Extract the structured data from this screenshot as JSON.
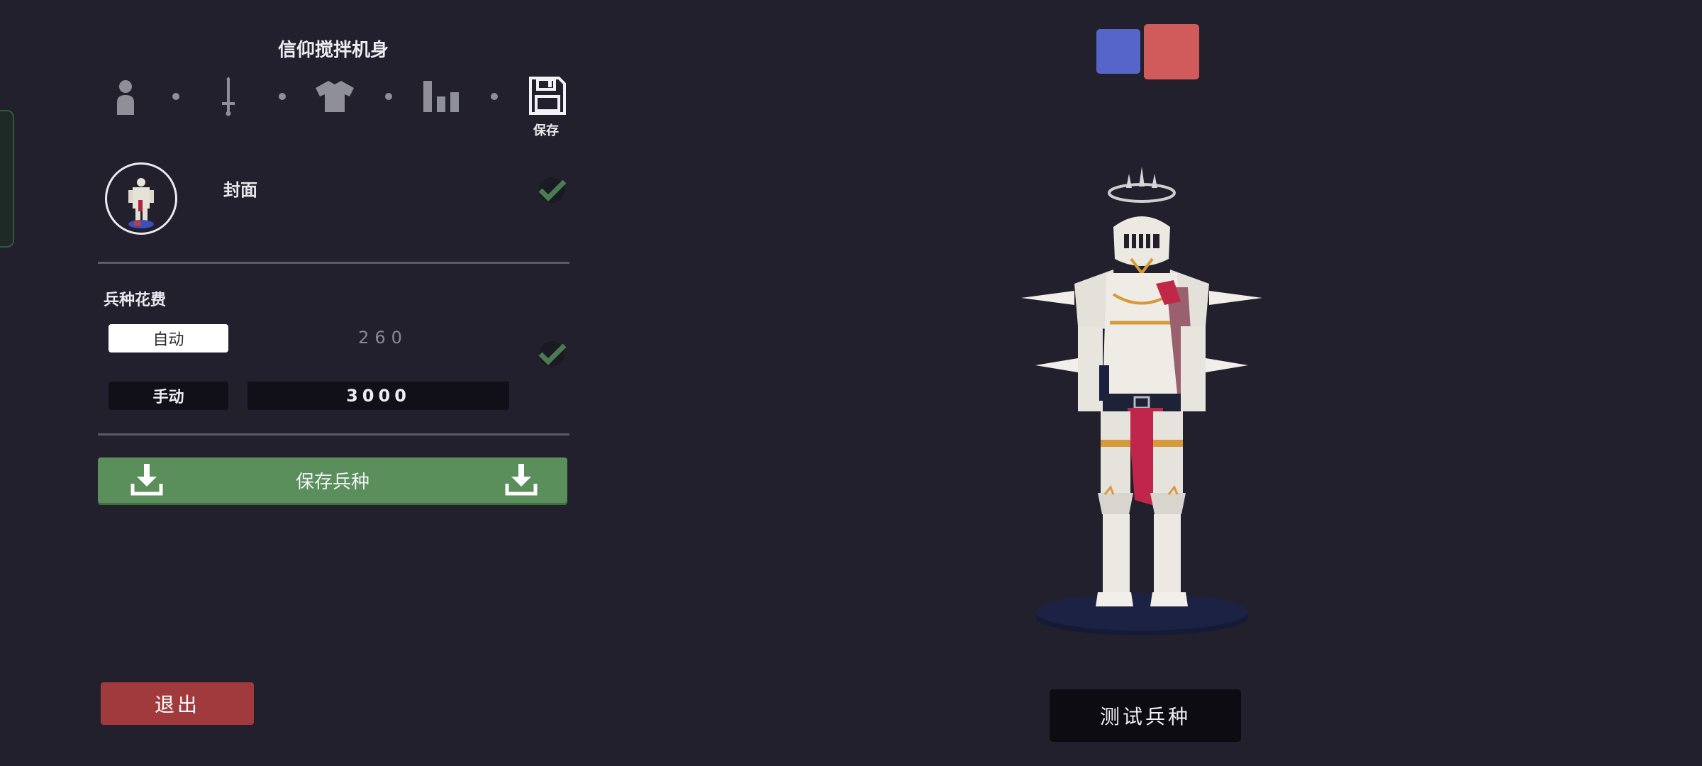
{
  "unit": {
    "name": "信仰搅拌机身"
  },
  "steps": {
    "items": [
      {
        "name": "person-icon"
      },
      {
        "name": "sword-icon"
      },
      {
        "name": "shirt-icon"
      },
      {
        "name": "stats-icon"
      },
      {
        "name": "floppy-disk-icon"
      }
    ],
    "save_label": "保存"
  },
  "cover": {
    "label": "封面"
  },
  "cost": {
    "label": "兵种花费",
    "auto_label": "自动",
    "auto_value": "260",
    "manual_label": "手动",
    "manual_value": "3000"
  },
  "actions": {
    "save_unit_label": "保存兵种",
    "exit_label": "退出",
    "test_label": "测试兵种"
  },
  "teams": {
    "blue_color": "#5565c8",
    "red_color": "#d15a5a"
  },
  "colors": {
    "background": "#21202c",
    "save_green": "#5a8e5a",
    "exit_red": "#a13a3d"
  }
}
